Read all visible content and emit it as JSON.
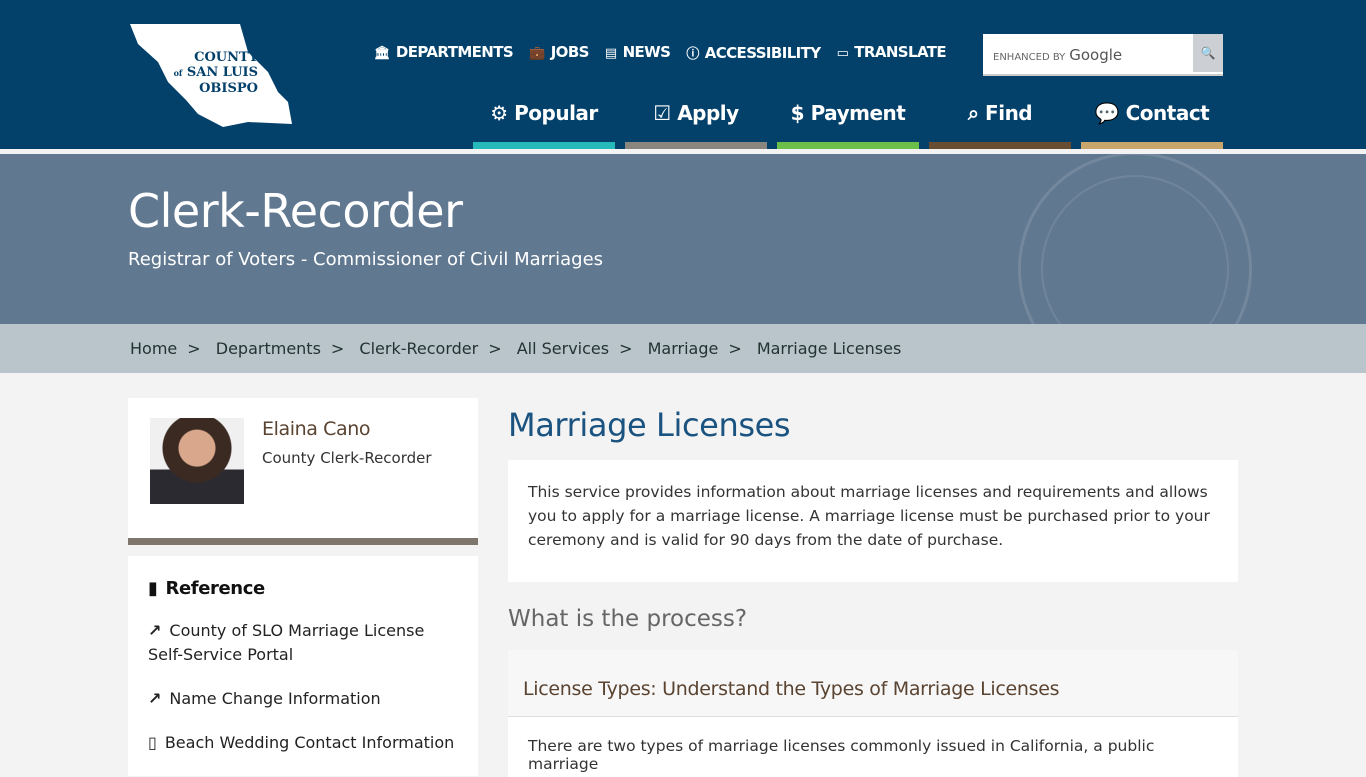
{
  "logo": {
    "line1": "COUNTY",
    "of": "of",
    "line2": "SAN LUIS",
    "line3": "OBISPO"
  },
  "utility_nav": [
    {
      "icon": "building-columns",
      "label": "DEPARTMENTS"
    },
    {
      "icon": "briefcase",
      "label": "JOBS"
    },
    {
      "icon": "newspaper",
      "label": "NEWS"
    },
    {
      "icon": "universal-access",
      "label": "ACCESSIBILITY"
    },
    {
      "icon": "language",
      "label": "TRANSLATE"
    }
  ],
  "search": {
    "enhanced": "ENHANCED BY",
    "brand": "Google"
  },
  "main_nav": [
    {
      "icon": "gear",
      "label": "Popular",
      "color": "#26b9b9"
    },
    {
      "icon": "check-square",
      "label": "Apply",
      "color": "#8b857f"
    },
    {
      "icon": "dollar",
      "label": "Payment",
      "color": "#6cc04a"
    },
    {
      "icon": "search",
      "label": "Find",
      "color": "#6a4e32"
    },
    {
      "icon": "comment",
      "label": "Contact",
      "color": "#c7a56b"
    }
  ],
  "banner": {
    "title": "Clerk-Recorder",
    "subtitle": "Registrar of Voters - Commissioner of Civil Marriages"
  },
  "breadcrumb": [
    "Home",
    "Departments",
    "Clerk-Recorder",
    "All Services",
    "Marriage",
    "Marriage Licenses"
  ],
  "person": {
    "name": "Elaina Cano",
    "title": "County Clerk-Recorder"
  },
  "reference": {
    "heading": "Reference",
    "links": [
      {
        "icon": "external-link",
        "label": "County of SLO Marriage License Self-Service Portal"
      },
      {
        "icon": "external-link",
        "label": "Name Change Information"
      },
      {
        "icon": "file",
        "label": "Beach Wedding Contact Information"
      }
    ]
  },
  "main": {
    "title": "Marriage Licenses",
    "intro": "This service provides information about marriage licenses and requirements and allows you to apply for a marriage license. A marriage license must be purchased prior to your ceremony and is valid for 90 days from the date of purchase.",
    "process_heading": "What is the process?",
    "accordion_title": "License Types: Understand the Types of Marriage Licenses",
    "accordion_text": "There are two types of marriage licenses commonly issued in California, a public marriage"
  }
}
